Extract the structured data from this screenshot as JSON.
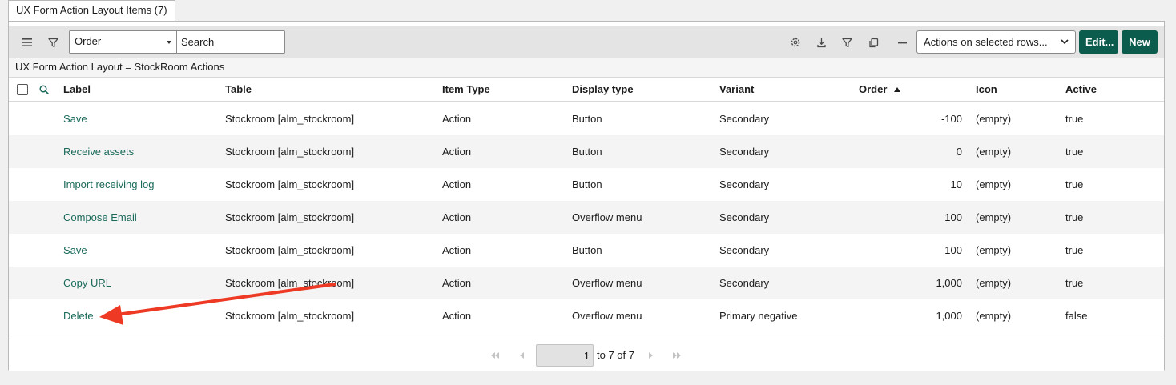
{
  "tab": {
    "label": "UX Form Action Layout Items (7)"
  },
  "toolbar": {
    "order_select_value": "Order",
    "search_placeholder": "Search",
    "actions_select_value": "Actions on selected rows...",
    "edit_label": "Edit...",
    "new_label": "New",
    "icons": [
      "menu-icon",
      "filter-icon",
      "gear-icon",
      "download-icon",
      "filter-icon",
      "copy-icon",
      "collapse-icon"
    ]
  },
  "breadcrumb": {
    "text": "UX Form Action Layout = StockRoom Actions"
  },
  "table": {
    "columns": [
      {
        "label": "Label"
      },
      {
        "label": "Table"
      },
      {
        "label": "Item Type"
      },
      {
        "label": "Display type"
      },
      {
        "label": "Variant"
      },
      {
        "label": "Order",
        "sort": "ascending"
      },
      {
        "label": "Icon"
      },
      {
        "label": "Active"
      }
    ],
    "rows": [
      {
        "label": "Save",
        "table": "Stockroom [alm_stockroom]",
        "item_type": "Action",
        "display_type": "Button",
        "variant": "Secondary",
        "order": "-100",
        "icon": "(empty)",
        "active": "true"
      },
      {
        "label": "Receive assets",
        "table": "Stockroom [alm_stockroom]",
        "item_type": "Action",
        "display_type": "Button",
        "variant": "Secondary",
        "order": "0",
        "icon": "(empty)",
        "active": "true"
      },
      {
        "label": "Import receiving log",
        "table": "Stockroom [alm_stockroom]",
        "item_type": "Action",
        "display_type": "Button",
        "variant": "Secondary",
        "order": "10",
        "icon": "(empty)",
        "active": "true"
      },
      {
        "label": "Compose Email",
        "table": "Stockroom [alm_stockroom]",
        "item_type": "Action",
        "display_type": "Overflow menu",
        "variant": "Secondary",
        "order": "100",
        "icon": "(empty)",
        "active": "true"
      },
      {
        "label": "Save",
        "table": "Stockroom [alm_stockroom]",
        "item_type": "Action",
        "display_type": "Button",
        "variant": "Secondary",
        "order": "100",
        "icon": "(empty)",
        "active": "true"
      },
      {
        "label": "Copy URL",
        "table": "Stockroom [alm_stockroom]",
        "item_type": "Action",
        "display_type": "Overflow menu",
        "variant": "Secondary",
        "order": "1,000",
        "icon": "(empty)",
        "active": "true"
      },
      {
        "label": "Delete",
        "table": "Stockroom [alm_stockroom]",
        "item_type": "Action",
        "display_type": "Overflow menu",
        "variant": "Primary negative",
        "order": "1,000",
        "icon": "(empty)",
        "active": "false"
      }
    ]
  },
  "pagination": {
    "current_page": "1",
    "range_text": "to 7 of 7"
  },
  "colors": {
    "primary": "#0b5c4d",
    "link": "#1a6a5a",
    "annotation_arrow": "#ee3a24"
  }
}
